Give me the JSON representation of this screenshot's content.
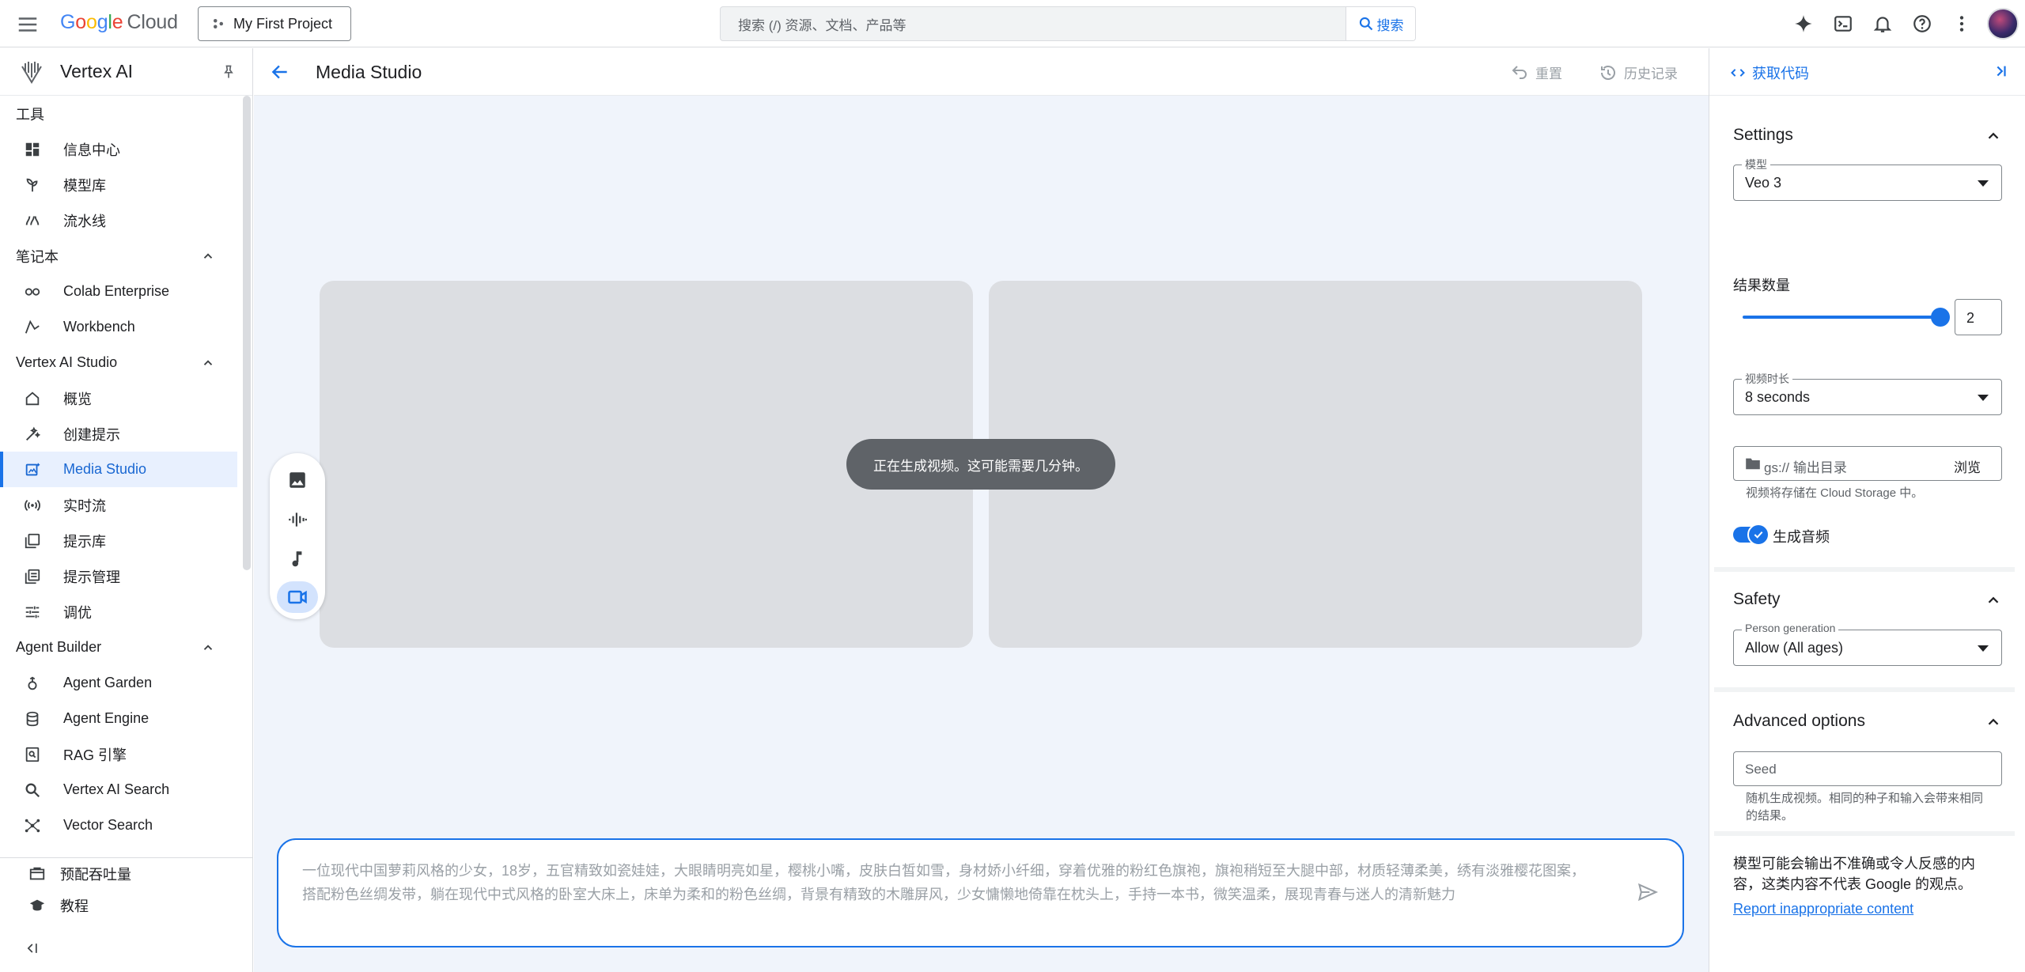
{
  "topbar": {
    "logo_google": [
      "G",
      "o",
      "o",
      "g",
      "l",
      "e"
    ],
    "logo_cloud": "Cloud",
    "project": "My First Project",
    "search_placeholder": "搜索 (/) 资源、文档、产品等",
    "search_button": "搜索"
  },
  "sidebar": {
    "title": "Vertex AI",
    "sections": [
      {
        "label": "工具",
        "collapsible": false
      },
      {
        "label": "笔记本",
        "collapsible": true
      },
      {
        "label": "Vertex AI Studio",
        "collapsible": true
      },
      {
        "label": "Agent Builder",
        "collapsible": true
      }
    ],
    "tools": [
      {
        "label": "信息中心",
        "icon": "dashboard-icon"
      },
      {
        "label": "模型库",
        "icon": "model-garden-icon"
      },
      {
        "label": "流水线",
        "icon": "pipelines-icon"
      }
    ],
    "notebooks": [
      {
        "label": "Colab Enterprise",
        "icon": "colab-icon"
      },
      {
        "label": "Workbench",
        "icon": "workbench-icon"
      }
    ],
    "studio": [
      {
        "label": "概览",
        "icon": "home-icon"
      },
      {
        "label": "创建提示",
        "icon": "create-prompt-icon"
      },
      {
        "label": "Media Studio",
        "icon": "media-studio-icon",
        "active": true
      },
      {
        "label": "实时流",
        "icon": "stream-icon"
      },
      {
        "label": "提示库",
        "icon": "prompt-gallery-icon"
      },
      {
        "label": "提示管理",
        "icon": "prompt-management-icon"
      },
      {
        "label": "调优",
        "icon": "tuning-icon"
      }
    ],
    "agent_builder": [
      {
        "label": "Agent Garden",
        "icon": "agent-garden-icon"
      },
      {
        "label": "Agent Engine",
        "icon": "agent-engine-icon"
      },
      {
        "label": "RAG 引擎",
        "icon": "rag-engine-icon"
      },
      {
        "label": "Vertex AI Search",
        "icon": "search-icon"
      },
      {
        "label": "Vector Search",
        "icon": "vector-search-icon"
      }
    ],
    "bottom": [
      {
        "label": "预配吞吐量",
        "icon": "throughput-icon"
      },
      {
        "label": "教程",
        "icon": "school-icon"
      }
    ]
  },
  "main": {
    "title": "Media Studio",
    "reset_label": "重置",
    "history_label": "历史记录",
    "toast": "正在生成视频。这可能需要几分钟。",
    "prompt_text": "一位现代中国萝莉风格的少女，18岁，五官精致如瓷娃娃，大眼睛明亮如星，樱桃小嘴，皮肤白皙如雪，身材娇小纤细，穿着优雅的粉红色旗袍，旗袍稍短至大腿中部，材质轻薄柔美，绣有淡雅樱花图案，搭配粉色丝绸发带，躺在现代中式风格的卧室大床上，床单为柔和的粉色丝绸，背景有精致的木雕屏风，少女慵懒地倚靠在枕头上，手持一本书，微笑温柔，展现青春与迷人的清新魅力",
    "mode_icons": [
      "image-icon",
      "speech-icon",
      "music-icon",
      "video-icon"
    ]
  },
  "right_panel": {
    "get_code": "获取代码",
    "settings_title": "Settings",
    "model_label": "模型",
    "model_value": "Veo 3",
    "result_count_label": "结果数量",
    "result_count_value": "2",
    "duration_label": "视频时长",
    "duration_value": "8 seconds",
    "output_placeholder": "gs:// 输出目录",
    "browse_label": "浏览",
    "output_hint": "视频将存储在 Cloud Storage 中。",
    "audio_label": "生成音频",
    "audio_enabled": true,
    "safety_title": "Safety",
    "person_gen_label": "Person generation",
    "person_gen_value": "Allow (All ages)",
    "advanced_title": "Advanced options",
    "seed_placeholder": "Seed",
    "seed_hint": "随机生成视频。相同的种子和输入会带来相同的结果。",
    "disclaimer": "模型可能会输出不准确或令人反感的内容，这类内容不代表 Google 的观点。",
    "report_link": "Report inappropriate content"
  },
  "colors": {
    "accent": "#1a73e8",
    "active_bg": "#e8f0fe",
    "main_bg": "#f0f4fb",
    "panel_placeholder": "#dcdee2",
    "toast_bg": "#5f6368"
  }
}
